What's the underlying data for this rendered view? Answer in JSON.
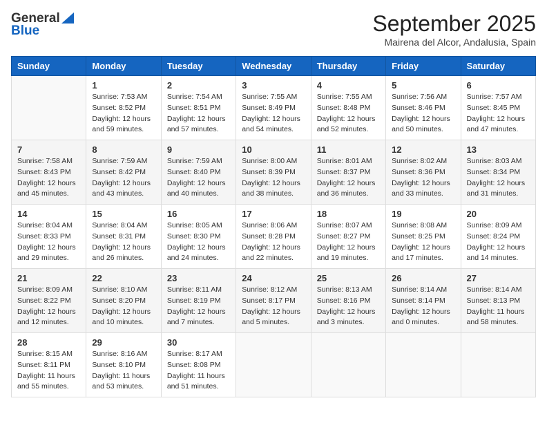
{
  "header": {
    "logo_general": "General",
    "logo_blue": "Blue",
    "month": "September 2025",
    "location": "Mairena del Alcor, Andalusia, Spain"
  },
  "weekdays": [
    "Sunday",
    "Monday",
    "Tuesday",
    "Wednesday",
    "Thursday",
    "Friday",
    "Saturday"
  ],
  "weeks": [
    [
      {
        "day": "",
        "info": ""
      },
      {
        "day": "1",
        "info": "Sunrise: 7:53 AM\nSunset: 8:52 PM\nDaylight: 12 hours\nand 59 minutes."
      },
      {
        "day": "2",
        "info": "Sunrise: 7:54 AM\nSunset: 8:51 PM\nDaylight: 12 hours\nand 57 minutes."
      },
      {
        "day": "3",
        "info": "Sunrise: 7:55 AM\nSunset: 8:49 PM\nDaylight: 12 hours\nand 54 minutes."
      },
      {
        "day": "4",
        "info": "Sunrise: 7:55 AM\nSunset: 8:48 PM\nDaylight: 12 hours\nand 52 minutes."
      },
      {
        "day": "5",
        "info": "Sunrise: 7:56 AM\nSunset: 8:46 PM\nDaylight: 12 hours\nand 50 minutes."
      },
      {
        "day": "6",
        "info": "Sunrise: 7:57 AM\nSunset: 8:45 PM\nDaylight: 12 hours\nand 47 minutes."
      }
    ],
    [
      {
        "day": "7",
        "info": "Sunrise: 7:58 AM\nSunset: 8:43 PM\nDaylight: 12 hours\nand 45 minutes."
      },
      {
        "day": "8",
        "info": "Sunrise: 7:59 AM\nSunset: 8:42 PM\nDaylight: 12 hours\nand 43 minutes."
      },
      {
        "day": "9",
        "info": "Sunrise: 7:59 AM\nSunset: 8:40 PM\nDaylight: 12 hours\nand 40 minutes."
      },
      {
        "day": "10",
        "info": "Sunrise: 8:00 AM\nSunset: 8:39 PM\nDaylight: 12 hours\nand 38 minutes."
      },
      {
        "day": "11",
        "info": "Sunrise: 8:01 AM\nSunset: 8:37 PM\nDaylight: 12 hours\nand 36 minutes."
      },
      {
        "day": "12",
        "info": "Sunrise: 8:02 AM\nSunset: 8:36 PM\nDaylight: 12 hours\nand 33 minutes."
      },
      {
        "day": "13",
        "info": "Sunrise: 8:03 AM\nSunset: 8:34 PM\nDaylight: 12 hours\nand 31 minutes."
      }
    ],
    [
      {
        "day": "14",
        "info": "Sunrise: 8:04 AM\nSunset: 8:33 PM\nDaylight: 12 hours\nand 29 minutes."
      },
      {
        "day": "15",
        "info": "Sunrise: 8:04 AM\nSunset: 8:31 PM\nDaylight: 12 hours\nand 26 minutes."
      },
      {
        "day": "16",
        "info": "Sunrise: 8:05 AM\nSunset: 8:30 PM\nDaylight: 12 hours\nand 24 minutes."
      },
      {
        "day": "17",
        "info": "Sunrise: 8:06 AM\nSunset: 8:28 PM\nDaylight: 12 hours\nand 22 minutes."
      },
      {
        "day": "18",
        "info": "Sunrise: 8:07 AM\nSunset: 8:27 PM\nDaylight: 12 hours\nand 19 minutes."
      },
      {
        "day": "19",
        "info": "Sunrise: 8:08 AM\nSunset: 8:25 PM\nDaylight: 12 hours\nand 17 minutes."
      },
      {
        "day": "20",
        "info": "Sunrise: 8:09 AM\nSunset: 8:24 PM\nDaylight: 12 hours\nand 14 minutes."
      }
    ],
    [
      {
        "day": "21",
        "info": "Sunrise: 8:09 AM\nSunset: 8:22 PM\nDaylight: 12 hours\nand 12 minutes."
      },
      {
        "day": "22",
        "info": "Sunrise: 8:10 AM\nSunset: 8:20 PM\nDaylight: 12 hours\nand 10 minutes."
      },
      {
        "day": "23",
        "info": "Sunrise: 8:11 AM\nSunset: 8:19 PM\nDaylight: 12 hours\nand 7 minutes."
      },
      {
        "day": "24",
        "info": "Sunrise: 8:12 AM\nSunset: 8:17 PM\nDaylight: 12 hours\nand 5 minutes."
      },
      {
        "day": "25",
        "info": "Sunrise: 8:13 AM\nSunset: 8:16 PM\nDaylight: 12 hours\nand 3 minutes."
      },
      {
        "day": "26",
        "info": "Sunrise: 8:14 AM\nSunset: 8:14 PM\nDaylight: 12 hours\nand 0 minutes."
      },
      {
        "day": "27",
        "info": "Sunrise: 8:14 AM\nSunset: 8:13 PM\nDaylight: 11 hours\nand 58 minutes."
      }
    ],
    [
      {
        "day": "28",
        "info": "Sunrise: 8:15 AM\nSunset: 8:11 PM\nDaylight: 11 hours\nand 55 minutes."
      },
      {
        "day": "29",
        "info": "Sunrise: 8:16 AM\nSunset: 8:10 PM\nDaylight: 11 hours\nand 53 minutes."
      },
      {
        "day": "30",
        "info": "Sunrise: 8:17 AM\nSunset: 8:08 PM\nDaylight: 11 hours\nand 51 minutes."
      },
      {
        "day": "",
        "info": ""
      },
      {
        "day": "",
        "info": ""
      },
      {
        "day": "",
        "info": ""
      },
      {
        "day": "",
        "info": ""
      }
    ]
  ]
}
